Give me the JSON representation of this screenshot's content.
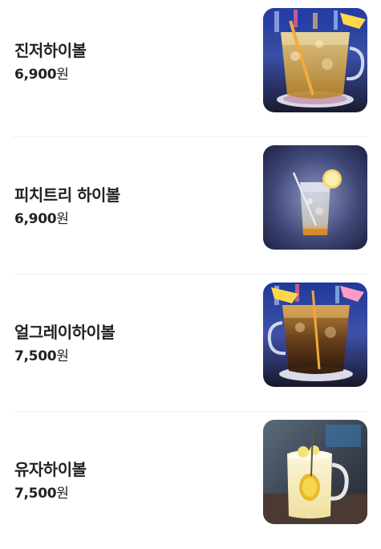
{
  "menu": {
    "items": [
      {
        "name": "진저하이볼",
        "price_number": "6,900",
        "price_unit": "원",
        "image": "ginger-highball-photo"
      },
      {
        "name": "피치트리 하이볼",
        "price_number": "6,900",
        "price_unit": "원",
        "image": "peach-tree-highball-photo"
      },
      {
        "name": "얼그레이하이볼",
        "price_number": "7,500",
        "price_unit": "원",
        "image": "earl-grey-highball-photo"
      },
      {
        "name": "유자하이볼",
        "price_number": "7,500",
        "price_unit": "원",
        "image": "yuzu-highball-photo"
      }
    ]
  }
}
